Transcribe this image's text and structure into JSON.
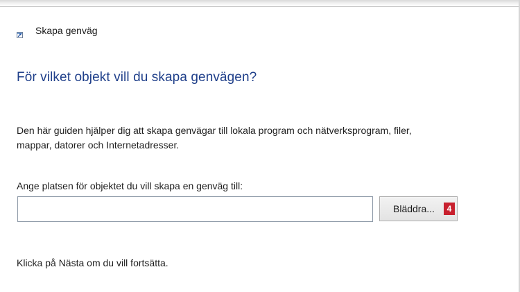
{
  "dialog": {
    "title": "Skapa genväg",
    "title_icon": "shortcut-icon"
  },
  "page": {
    "heading": "För vilket objekt vill du skapa genvägen?",
    "intro_line1": "Den här guiden hjälper dig att skapa genvägar till lokala program och nätverksprogram, filer,",
    "intro_line2": "mappar, datorer och Internetadresser.",
    "location_label": "Ange platsen för objektet du vill skapa en genväg till:",
    "location_value": "",
    "browse_label": "Bläddra...",
    "step_badge": "4",
    "continue_hint": "Klicka på Nästa om du vill fortsätta."
  },
  "colors": {
    "heading": "#1f3f8a",
    "badge": "#c8202e"
  }
}
